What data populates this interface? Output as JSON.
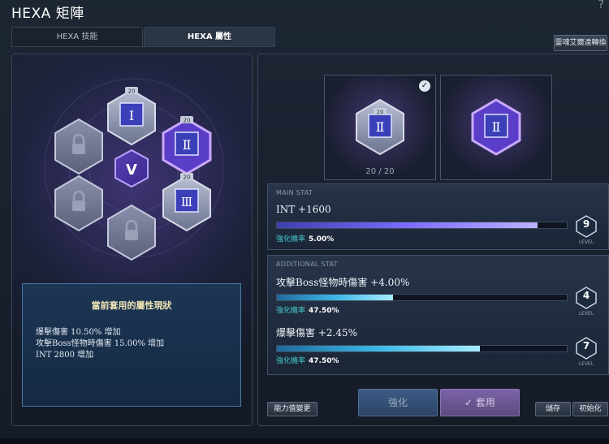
{
  "window": {
    "title": "HEXA 矩陣",
    "help": "?"
  },
  "tabs": [
    {
      "label": "HEXA 技能"
    },
    {
      "label": "HEXA 屬性"
    }
  ],
  "top_button": "靈魂艾爾達轉換",
  "hex_grid": {
    "center_label": "V",
    "level_badges": [
      "20",
      "20",
      "20",
      "20",
      "20"
    ],
    "cells": [
      {
        "label": "Ⅰ"
      },
      {
        "label": "Ⅱ"
      },
      {
        "label": "Ⅲ"
      }
    ]
  },
  "current_stats": {
    "title": "當前套用的屬性現狀",
    "lines": [
      "爆擊傷害 10.50% 增加",
      "攻擊Boss怪物時傷害 15.00% 增加",
      "INT 2800 增加"
    ]
  },
  "cards": {
    "left": {
      "badge": "20",
      "label": "Ⅱ",
      "count": "20 / 20"
    },
    "right": {
      "label": "Ⅱ"
    }
  },
  "main_stat": {
    "section_label": "MAIN STAT",
    "name": "INT +1600",
    "progress": 0.9,
    "rate_label": "強化機率",
    "rate_value": "5.00%",
    "level": "9",
    "level_text": "LEVEL"
  },
  "additional_stat": {
    "section_label": "ADDITIONAL STAT",
    "items": [
      {
        "name": "攻擊Boss怪物時傷害 +4.00%",
        "progress": 0.4,
        "rate_label": "強化機率",
        "rate_value": "47.50%",
        "level": "4",
        "level_text": "LEVEL"
      },
      {
        "name": "爆擊傷害 +2.45%",
        "progress": 0.7,
        "rate_label": "強化機率",
        "rate_value": "47.50%",
        "level": "7",
        "level_text": "LEVEL"
      }
    ]
  },
  "buttons": {
    "change": "能力值變更",
    "enhance": "強化",
    "apply": "套用",
    "save": "儲存",
    "init": "初始化"
  },
  "colors": {
    "accent_purple": "#7c6cff",
    "accent_cyan": "#3cb8e6",
    "rate_teal": "#46c9c9"
  }
}
